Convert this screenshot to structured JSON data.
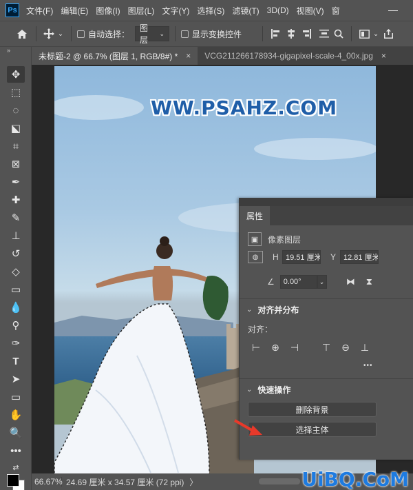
{
  "app": {
    "logo": "Ps"
  },
  "menu": [
    "文件(F)",
    "编辑(E)",
    "图像(I)",
    "图层(L)",
    "文字(Y)",
    "选择(S)",
    "滤镜(T)",
    "3D(D)",
    "视图(V)",
    "窗"
  ],
  "window_controls": {
    "minimize": "—"
  },
  "options": {
    "auto_select_label": "自动选择：",
    "layer_select_value": "图层",
    "show_transform_label": "显示变换控件"
  },
  "tabs": [
    {
      "label": "未标题-2 @ 66.7% (图层 1, RGB/8#) *",
      "close": "×"
    },
    {
      "label": "VCG211266178934-gigapixel-scale-4_00x.jpg",
      "close": "×"
    }
  ],
  "canvas": {
    "watermark": "WW.PSAHZ.COM"
  },
  "status": {
    "zoom": "66.67%",
    "doc_size": "24.69 厘米 x 34.57 厘米 (72 ppi)",
    "arrow": "〉"
  },
  "site_watermark": "UiBQ.CoM",
  "properties": {
    "tab": "属性",
    "layer_type": "像素图层",
    "h_label": "H",
    "h_value": "19.51 厘米",
    "y_label": "Y",
    "y_value": "12.81 厘米",
    "angle_value": "0.00°",
    "align_section": "对齐并分布",
    "align_label": "对齐：",
    "more": "•••",
    "quick_section": "快速操作",
    "remove_bg_btn": "删除背景",
    "select_subject_btn": "选择主体"
  },
  "colors": {
    "accent": "#31a8ff",
    "ui_bg": "#535353",
    "panel_dark": "#424242",
    "arrow_red": "#e8392a"
  },
  "icons": [
    "home-icon",
    "move-icon",
    "align-left-icon",
    "search-icon",
    "share-icon"
  ]
}
